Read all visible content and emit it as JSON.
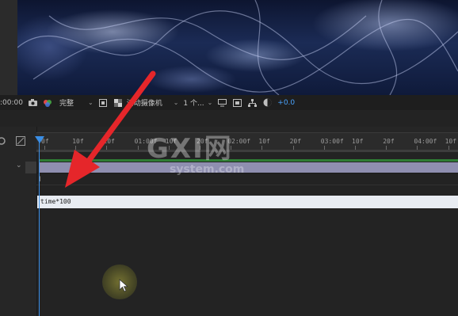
{
  "viewer": {
    "toolbar": {
      "timecode": ":00:00",
      "resolution": "完整",
      "camera": "活动摄像机",
      "views": "1 个...",
      "exposure": "+0.0"
    }
  },
  "timeline": {
    "ruler_ticks": [
      "0f",
      "10f",
      "20f",
      "01:00f",
      "10f",
      "20f",
      "02:00f",
      "10f",
      "20f",
      "03:00f",
      "10f",
      "20f",
      "04:00f",
      "10f"
    ],
    "expression": "time*100"
  },
  "overlay": {
    "watermark": "GXI网",
    "watermark_sub": "system.com",
    "arrow_color": "#e5262a"
  }
}
